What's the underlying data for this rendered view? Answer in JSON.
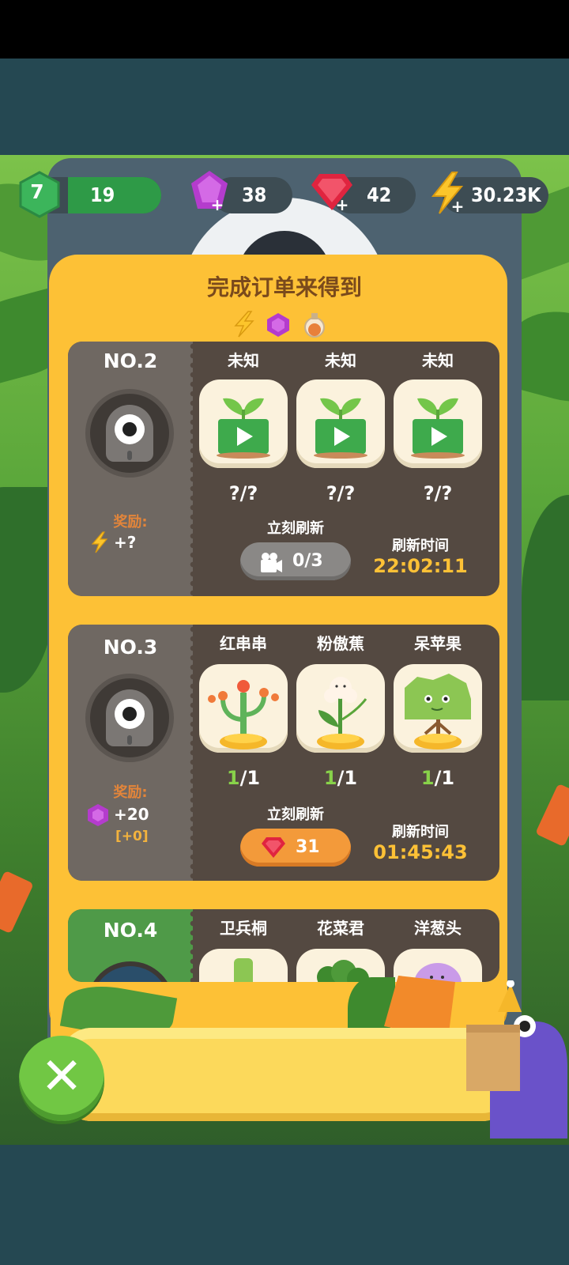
{
  "resources": {
    "level": "7",
    "leaves": "19",
    "purple_gems": "38",
    "red_gems": "42",
    "energy": "30.23K"
  },
  "panel": {
    "title": "完成订单来得到",
    "title_icons": [
      "lightning-icon",
      "purple-gem-icon",
      "potion-icon"
    ]
  },
  "orders": [
    {
      "number": "NO.2",
      "reward_label": "奖励:",
      "reward_icon": "lightning-icon",
      "reward_value": "+?",
      "items": [
        {
          "name": "未知",
          "count_have": "?",
          "count_need": "/?",
          "icon": "sprout-video-icon"
        },
        {
          "name": "未知",
          "count_have": "?",
          "count_need": "/?",
          "icon": "sprout-video-icon"
        },
        {
          "name": "未知",
          "count_have": "?",
          "count_need": "/?",
          "icon": "sprout-video-icon"
        }
      ],
      "refresh_label": "立刻刷新",
      "refresh_button": "0/3",
      "refresh_icon": "video-icon",
      "time_label": "刷新时间",
      "time_value": "22:02:11"
    },
    {
      "number": "NO.3",
      "reward_label": "奖励:",
      "reward_icon": "purple-gem-icon",
      "reward_value": "+20",
      "reward_bonus": "[+0]",
      "items": [
        {
          "name": "红串串",
          "count_have": "1",
          "count_need": "/1",
          "icon": "red-cactus-icon"
        },
        {
          "name": "粉傲蕉",
          "count_have": "1",
          "count_need": "/1",
          "icon": "flower-icon"
        },
        {
          "name": "呆苹果",
          "count_have": "1",
          "count_need": "/1",
          "icon": "apple-tree-icon"
        }
      ],
      "refresh_label": "立刻刷新",
      "refresh_button": "31",
      "refresh_icon": "red-gem-icon",
      "time_label": "刷新时间",
      "time_value": "01:45:43"
    },
    {
      "number": "NO.4",
      "items": [
        {
          "name": "卫兵桐",
          "icon": "plant-icon"
        },
        {
          "name": "花菜君",
          "icon": "broccoli-icon"
        },
        {
          "name": "洋葱头",
          "icon": "onion-icon"
        }
      ]
    }
  ],
  "close_button": "✕"
}
